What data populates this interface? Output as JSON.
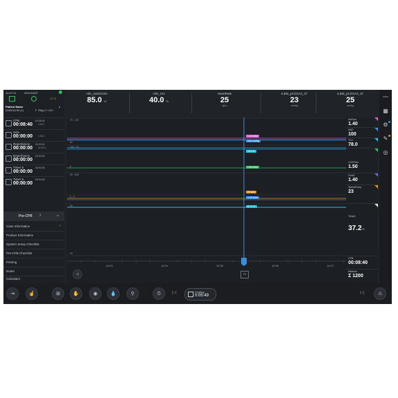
{
  "status_bar": {
    "time": "14:07:21",
    "date": "2021/03/07",
    "alarms": "2 / 3"
  },
  "patient": {
    "label": "Patient Name",
    "id": "2020/10/30 (1)",
    "info": "F 75kg 0 / 120"
  },
  "timers": [
    {
      "label": "CPB",
      "value": "00:08:40",
      "side1": "00:08:40",
      "side2": "1:00:1"
    },
    {
      "label": "Xcla",
      "value": "00:00:00",
      "side1": "",
      "side2": "1:06:1"
    },
    {
      "label": "Reperfusion",
      "value": "00:00:00",
      "side1": "00:00:00",
      "side2": "00:00:1"
    },
    {
      "label": "Reperfusion",
      "value": "00:00:00",
      "side1": "00:00:00",
      "side2": ""
    },
    {
      "label": "Timer 5",
      "value": "00:00:00",
      "side1": "00:00:00",
      "side2": ""
    },
    {
      "label": "Timer 6",
      "value": "00:00:00",
      "side1": "00:00:00",
      "side2": ""
    }
  ],
  "precpb": {
    "label": "Pre-CPB"
  },
  "menu": [
    "Case Information",
    "Product Information",
    "System Setup Checklist",
    "Pre-CPB Checklist",
    "Priming",
    "Notes",
    "Calculator"
  ],
  "header": [
    {
      "name": "Hlm_SatO2Ven",
      "value": "85.0",
      "unit": "%"
    },
    {
      "name": "Hlm_Hct",
      "value": "40.0",
      "unit": "%"
    },
    {
      "name": "HeartRate",
      "value": "25",
      "unit": "bpm"
    },
    {
      "name": "ILBM_pCO2Art_37",
      "value": "23",
      "unit": "mmHg"
    },
    {
      "name": "ILBM_pCO2Art_37",
      "value": "25",
      "unit": "mmHg"
    }
  ],
  "right_params": [
    {
      "name": "ArtFlow",
      "value": "1.40",
      "color": "#e060d0"
    },
    {
      "name": "MAP",
      "value": "100",
      "color": "#3a8ee0"
    },
    {
      "name": "TC2",
      "value": "78.0",
      "color": "#20c0e0"
    },
    {
      "name": "CO2Flow",
      "value": "1.50",
      "color": "#30c060"
    },
    {
      "name": "Flow2",
      "value": "1.40",
      "color": "#6a6ae0"
    },
    {
      "name": "SpeedPump",
      "value": "23",
      "color": "#e09020"
    },
    {
      "name": "Temp1",
      "value": "37.2",
      "unit": "°C",
      "color": "#e0e0e0"
    }
  ],
  "chart": {
    "time_ticks": [
      "14:03",
      "14:04",
      "14:05",
      "14:06",
      "14:07"
    ],
    "markers": [
      "1.40 l/min",
      "100 mmHg",
      "78.0 %",
      "1.50 l/min",
      "23 rpm",
      "1.40 l/min",
      "37.2 °C"
    ],
    "marker_colors": [
      "#e060d0",
      "#3a8ee0",
      "#20c0e0",
      "#30c060",
      "#e09020",
      "#3a8ee0",
      "#20c0e0"
    ]
  },
  "right_bottom": {
    "cpb_label": "CPB",
    "cpb_value": "00:08:40",
    "balance_label": "Balance",
    "balance_value": "Σ 1200"
  },
  "cooling": {
    "label": "Cooling",
    "value": "0:05:49"
  }
}
